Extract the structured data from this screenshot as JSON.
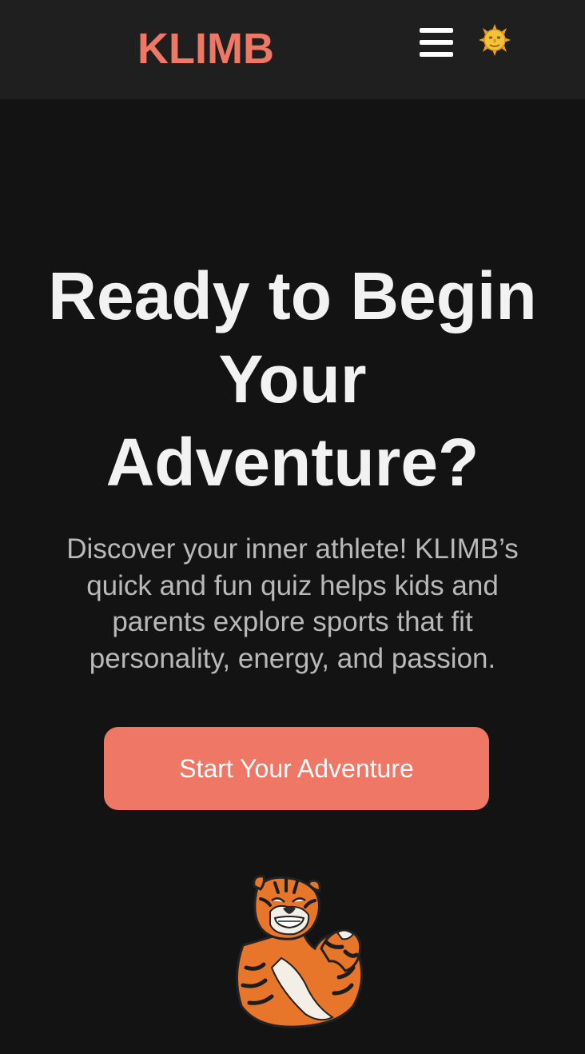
{
  "header": {
    "logo_text": "KLIMB",
    "menu_icon": "hamburger-menu-icon",
    "theme_icon": "sun-face-icon"
  },
  "hero": {
    "title_lines": [
      "Ready to Begin",
      "Your",
      "Adventure?"
    ],
    "description_lines": [
      "Discover your inner athlete! KLIMB’s",
      "quick and fun quiz helps kids and",
      "parents explore sports that fit",
      "personality, energy, and passion."
    ],
    "cta_label": "Start Your Adventure",
    "mascot_icon": "tiger-mascot-icon"
  },
  "colors": {
    "accent": "#ee7766",
    "background": "#131313",
    "header_background": "#1f1f1f",
    "title_text": "#f2f2f2",
    "body_text": "#b9b9b9"
  }
}
